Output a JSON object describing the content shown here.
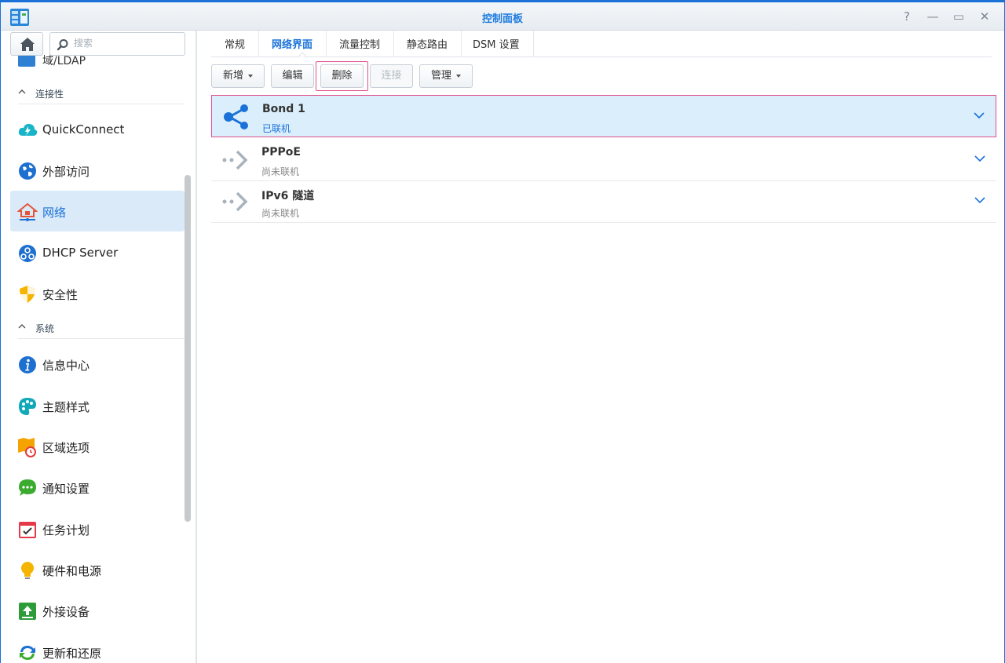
{
  "window": {
    "title": "控制面板",
    "controls": [
      "?",
      "—",
      "▭",
      "✕"
    ]
  },
  "sidebar": {
    "search_placeholder": "搜索",
    "partial_item": "域/LDAP",
    "sections": [
      {
        "title": "连接性",
        "items": [
          {
            "label": "QuickConnect",
            "icon": "quickconnect-icon"
          },
          {
            "label": "外部访问",
            "icon": "globe-icon"
          },
          {
            "label": "网络",
            "icon": "network-home-icon",
            "active": true
          },
          {
            "label": "DHCP Server",
            "icon": "dhcp-icon"
          },
          {
            "label": "安全性",
            "icon": "shield-icon"
          }
        ]
      },
      {
        "title": "系统",
        "items": [
          {
            "label": "信息中心",
            "icon": "info-icon"
          },
          {
            "label": "主题样式",
            "icon": "palette-icon"
          },
          {
            "label": "区域选项",
            "icon": "map-clock-icon"
          },
          {
            "label": "通知设置",
            "icon": "chat-icon"
          },
          {
            "label": "任务计划",
            "icon": "calendar-check-icon"
          },
          {
            "label": "硬件和电源",
            "icon": "lightbulb-icon"
          },
          {
            "label": "外接设备",
            "icon": "upload-icon"
          },
          {
            "label": "更新和还原",
            "icon": "refresh-icon"
          }
        ]
      }
    ]
  },
  "main": {
    "tabs": [
      "常规",
      "网络界面",
      "流量控制",
      "静态路由",
      "DSM 设置"
    ],
    "active_tab": "网络界面",
    "toolbar": {
      "new_label": "新增",
      "edit_label": "编辑",
      "delete_label": "删除",
      "connect_label": "连接",
      "manage_label": "管理"
    },
    "interfaces": [
      {
        "name": "Bond 1",
        "status": "已联机",
        "icon": "bond-share-icon",
        "selected": true
      },
      {
        "name": "PPPoE",
        "status": "尚未联机",
        "icon": "pppoe-arrow-icon"
      },
      {
        "name": "IPv6 隧道",
        "status": "尚未联机",
        "icon": "tunnel-arrow-icon"
      }
    ]
  },
  "colors": {
    "accent": "#1a72d9",
    "highlight": "#e0508c",
    "selected_bg": "#daeefb"
  }
}
